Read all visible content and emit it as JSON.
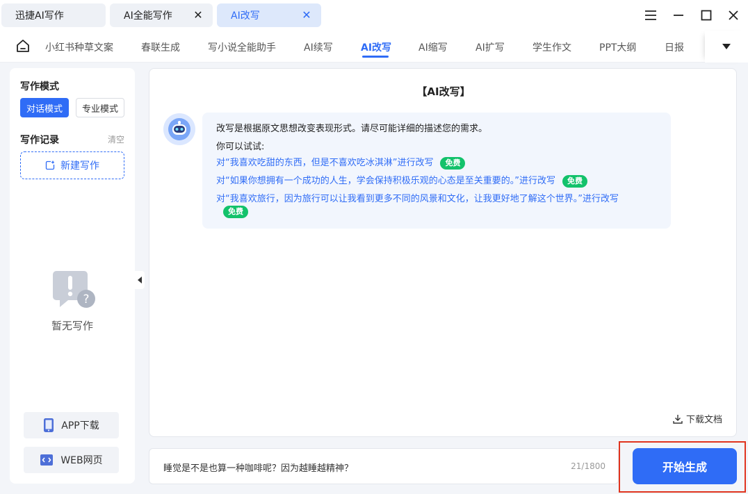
{
  "window_tabs": [
    {
      "label": "迅捷AI写作"
    },
    {
      "label": "AI全能写作"
    },
    {
      "label": "AI改写"
    }
  ],
  "nav": {
    "items": [
      "小红书种草文案",
      "春联生成",
      "写小说全能助手",
      "AI续写",
      "AI改写",
      "AI缩写",
      "AI扩写",
      "学生作文",
      "PPT大纲",
      "日报"
    ],
    "active": "AI改写"
  },
  "sidebar": {
    "mode_title": "写作模式",
    "mode_chat": "对话模式",
    "mode_pro": "专业模式",
    "record_title": "写作记录",
    "clear": "清空",
    "new_write": "新建写作",
    "empty": "暂无写作",
    "app_download": "APP下载",
    "web": "WEB网页"
  },
  "main": {
    "title": "【AI改写】",
    "intro": "改写是根据原文思想改变表现形式。请尽可能详细的描述您的需求。",
    "try_label": "你可以试试:",
    "suggestions": [
      "对“我喜欢吃甜的东西，但是不喜欢吃冰淇淋”进行改写",
      "对“如果你想拥有一个成功的人生，学会保持积极乐观的心态是至关重要的。”进行改写",
      "对“我喜欢旅行，因为旅行可以让我看到更多不同的风景和文化，让我更好地了解这个世界。”进行改写"
    ],
    "free_badge": "免费",
    "download": "下载文档"
  },
  "input": {
    "value": "睡觉是不是也算一种咖啡呢？因为越睡越精神？",
    "counter": "21/1800"
  },
  "generate_label": "开始生成",
  "colors": {
    "accent": "#2f6cf6",
    "free_badge": "#13c26b",
    "highlight_box": "#e0341e"
  }
}
